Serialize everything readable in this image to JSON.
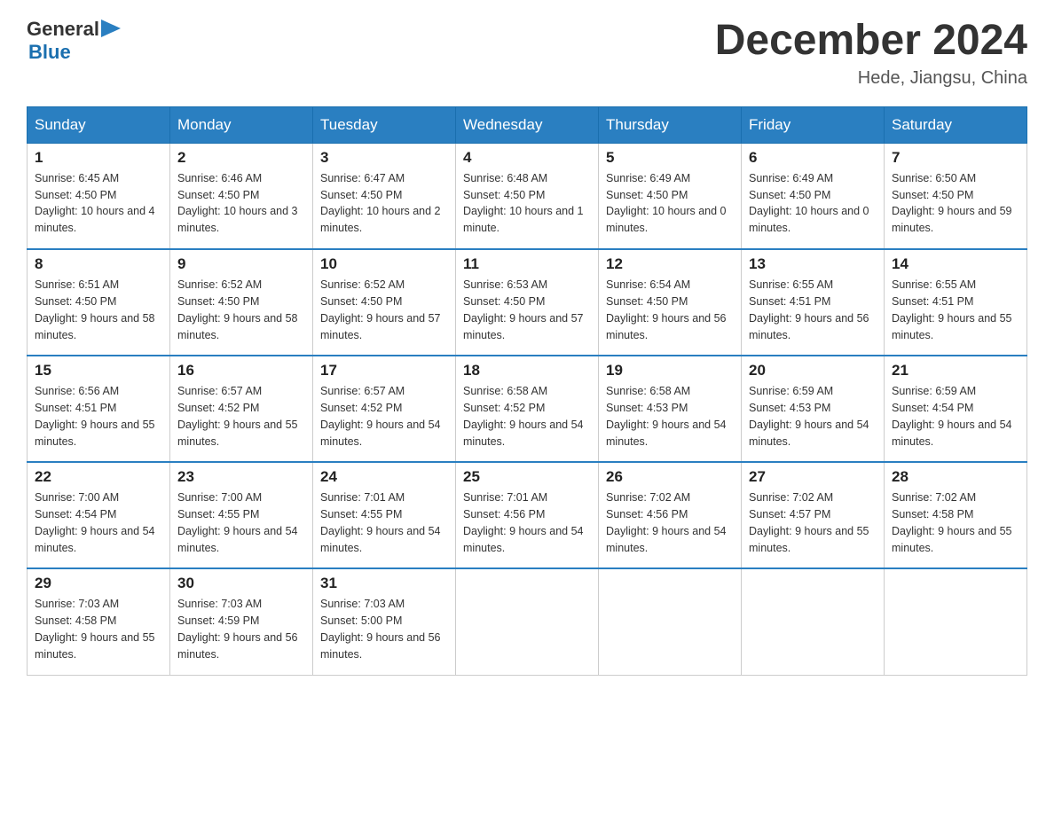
{
  "header": {
    "logo_general": "General",
    "logo_blue": "Blue",
    "month_title": "December 2024",
    "location": "Hede, Jiangsu, China"
  },
  "days_of_week": [
    "Sunday",
    "Monday",
    "Tuesday",
    "Wednesday",
    "Thursday",
    "Friday",
    "Saturday"
  ],
  "weeks": [
    [
      {
        "day": "1",
        "sunrise": "6:45 AM",
        "sunset": "4:50 PM",
        "daylight": "10 hours and 4 minutes."
      },
      {
        "day": "2",
        "sunrise": "6:46 AM",
        "sunset": "4:50 PM",
        "daylight": "10 hours and 3 minutes."
      },
      {
        "day": "3",
        "sunrise": "6:47 AM",
        "sunset": "4:50 PM",
        "daylight": "10 hours and 2 minutes."
      },
      {
        "day": "4",
        "sunrise": "6:48 AM",
        "sunset": "4:50 PM",
        "daylight": "10 hours and 1 minute."
      },
      {
        "day": "5",
        "sunrise": "6:49 AM",
        "sunset": "4:50 PM",
        "daylight": "10 hours and 0 minutes."
      },
      {
        "day": "6",
        "sunrise": "6:49 AM",
        "sunset": "4:50 PM",
        "daylight": "10 hours and 0 minutes."
      },
      {
        "day": "7",
        "sunrise": "6:50 AM",
        "sunset": "4:50 PM",
        "daylight": "9 hours and 59 minutes."
      }
    ],
    [
      {
        "day": "8",
        "sunrise": "6:51 AM",
        "sunset": "4:50 PM",
        "daylight": "9 hours and 58 minutes."
      },
      {
        "day": "9",
        "sunrise": "6:52 AM",
        "sunset": "4:50 PM",
        "daylight": "9 hours and 58 minutes."
      },
      {
        "day": "10",
        "sunrise": "6:52 AM",
        "sunset": "4:50 PM",
        "daylight": "9 hours and 57 minutes."
      },
      {
        "day": "11",
        "sunrise": "6:53 AM",
        "sunset": "4:50 PM",
        "daylight": "9 hours and 57 minutes."
      },
      {
        "day": "12",
        "sunrise": "6:54 AM",
        "sunset": "4:50 PM",
        "daylight": "9 hours and 56 minutes."
      },
      {
        "day": "13",
        "sunrise": "6:55 AM",
        "sunset": "4:51 PM",
        "daylight": "9 hours and 56 minutes."
      },
      {
        "day": "14",
        "sunrise": "6:55 AM",
        "sunset": "4:51 PM",
        "daylight": "9 hours and 55 minutes."
      }
    ],
    [
      {
        "day": "15",
        "sunrise": "6:56 AM",
        "sunset": "4:51 PM",
        "daylight": "9 hours and 55 minutes."
      },
      {
        "day": "16",
        "sunrise": "6:57 AM",
        "sunset": "4:52 PM",
        "daylight": "9 hours and 55 minutes."
      },
      {
        "day": "17",
        "sunrise": "6:57 AM",
        "sunset": "4:52 PM",
        "daylight": "9 hours and 54 minutes."
      },
      {
        "day": "18",
        "sunrise": "6:58 AM",
        "sunset": "4:52 PM",
        "daylight": "9 hours and 54 minutes."
      },
      {
        "day": "19",
        "sunrise": "6:58 AM",
        "sunset": "4:53 PM",
        "daylight": "9 hours and 54 minutes."
      },
      {
        "day": "20",
        "sunrise": "6:59 AM",
        "sunset": "4:53 PM",
        "daylight": "9 hours and 54 minutes."
      },
      {
        "day": "21",
        "sunrise": "6:59 AM",
        "sunset": "4:54 PM",
        "daylight": "9 hours and 54 minutes."
      }
    ],
    [
      {
        "day": "22",
        "sunrise": "7:00 AM",
        "sunset": "4:54 PM",
        "daylight": "9 hours and 54 minutes."
      },
      {
        "day": "23",
        "sunrise": "7:00 AM",
        "sunset": "4:55 PM",
        "daylight": "9 hours and 54 minutes."
      },
      {
        "day": "24",
        "sunrise": "7:01 AM",
        "sunset": "4:55 PM",
        "daylight": "9 hours and 54 minutes."
      },
      {
        "day": "25",
        "sunrise": "7:01 AM",
        "sunset": "4:56 PM",
        "daylight": "9 hours and 54 minutes."
      },
      {
        "day": "26",
        "sunrise": "7:02 AM",
        "sunset": "4:56 PM",
        "daylight": "9 hours and 54 minutes."
      },
      {
        "day": "27",
        "sunrise": "7:02 AM",
        "sunset": "4:57 PM",
        "daylight": "9 hours and 55 minutes."
      },
      {
        "day": "28",
        "sunrise": "7:02 AM",
        "sunset": "4:58 PM",
        "daylight": "9 hours and 55 minutes."
      }
    ],
    [
      {
        "day": "29",
        "sunrise": "7:03 AM",
        "sunset": "4:58 PM",
        "daylight": "9 hours and 55 minutes."
      },
      {
        "day": "30",
        "sunrise": "7:03 AM",
        "sunset": "4:59 PM",
        "daylight": "9 hours and 56 minutes."
      },
      {
        "day": "31",
        "sunrise": "7:03 AM",
        "sunset": "5:00 PM",
        "daylight": "9 hours and 56 minutes."
      },
      null,
      null,
      null,
      null
    ]
  ]
}
